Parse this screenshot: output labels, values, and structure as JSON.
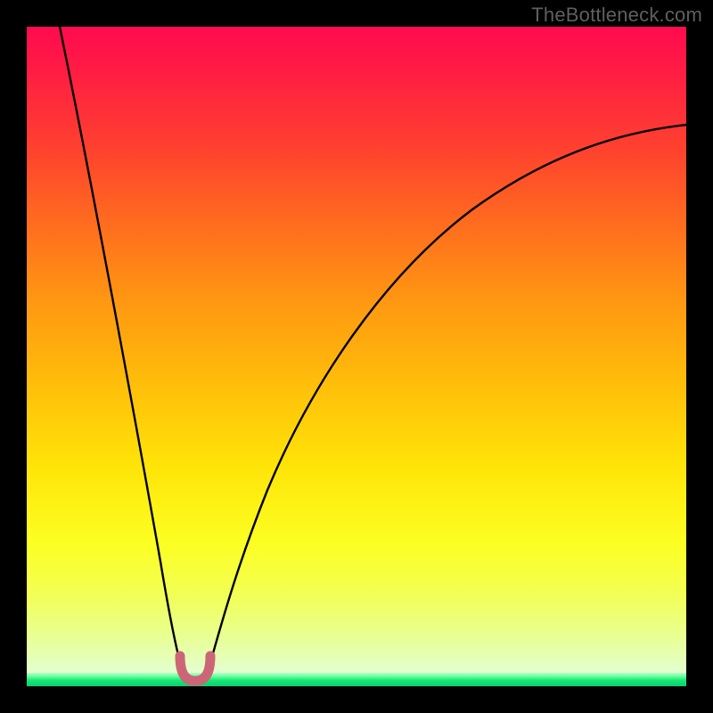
{
  "watermark": {
    "text": "TheBottleneck.com"
  },
  "chart_data": {
    "type": "line",
    "title": "",
    "xlabel": "",
    "ylabel": "",
    "xlim": [
      0,
      100
    ],
    "ylim": [
      0,
      100
    ],
    "background_gradient": {
      "direction": "vertical",
      "stops": [
        {
          "pos": 0.0,
          "color": "#ff0b4f"
        },
        {
          "pos": 0.18,
          "color": "#ff3e30"
        },
        {
          "pos": 0.42,
          "color": "#ff9612"
        },
        {
          "pos": 0.68,
          "color": "#ffe408"
        },
        {
          "pos": 0.88,
          "color": "#f2ff56"
        },
        {
          "pos": 0.98,
          "color": "#e3ffd0"
        },
        {
          "pos": 1.0,
          "color": "#0bcf6e"
        }
      ]
    },
    "series": [
      {
        "name": "left-branch",
        "color": "#000000",
        "x": [
          5,
          8,
          11,
          14,
          17,
          19,
          20.5,
          22,
          23.5
        ],
        "y": [
          100,
          82,
          64,
          46,
          28,
          14,
          6,
          2.5,
          1.8
        ]
      },
      {
        "name": "right-branch",
        "color": "#000000",
        "x": [
          27.5,
          29,
          32,
          36,
          42,
          50,
          60,
          72,
          86,
          100
        ],
        "y": [
          1.8,
          5,
          14,
          27,
          42,
          56,
          67,
          75,
          81,
          85
        ]
      },
      {
        "name": "optimal-u-marker",
        "color": "#cc6677",
        "marker": "u-shape",
        "x": [
          23.5,
          25.5,
          27.5
        ],
        "y": [
          3.5,
          0.8,
          3.5
        ]
      }
    ],
    "note": "x/y in 0–100 plot coords (origin bottom-left). Values estimated from pixels; curve is a bottleneck-style V with minimum near x≈25."
  }
}
